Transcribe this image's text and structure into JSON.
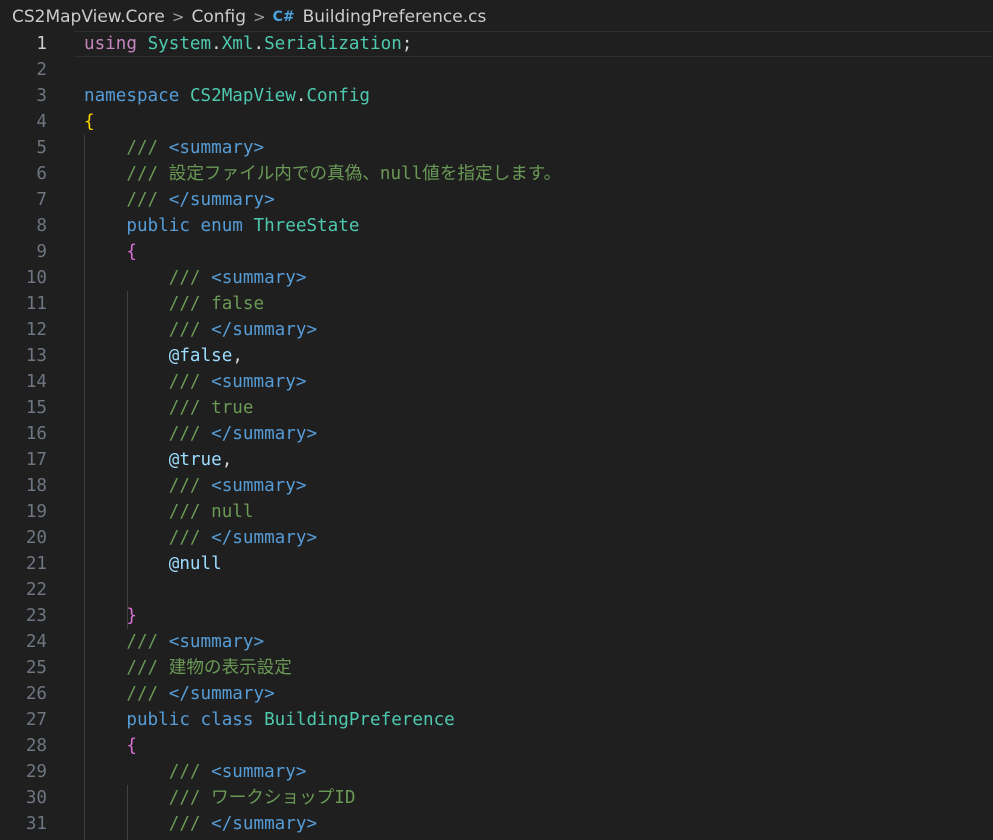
{
  "breadcrumb": {
    "items": [
      "CS2MapView.Core",
      "Config",
      "BuildingPreference.cs"
    ],
    "file_icon": "C#",
    "separator": ">"
  },
  "editor": {
    "active_line": 1,
    "lines": [
      {
        "n": 1,
        "tokens": [
          [
            "kw-pink",
            "using"
          ],
          [
            "plain",
            " "
          ],
          [
            "ns",
            "System"
          ],
          [
            "plain",
            "."
          ],
          [
            "ns",
            "Xml"
          ],
          [
            "plain",
            "."
          ],
          [
            "ns",
            "Serialization"
          ],
          [
            "plain",
            ";"
          ]
        ]
      },
      {
        "n": 2,
        "tokens": []
      },
      {
        "n": 3,
        "tokens": [
          [
            "kw",
            "namespace"
          ],
          [
            "plain",
            " "
          ],
          [
            "ns",
            "CS2MapView"
          ],
          [
            "plain",
            "."
          ],
          [
            "ns",
            "Config"
          ]
        ]
      },
      {
        "n": 4,
        "tokens": [
          [
            "br1",
            "{"
          ]
        ]
      },
      {
        "n": 5,
        "tokens": [
          [
            "plain",
            "    "
          ],
          [
            "cm",
            "/// "
          ],
          [
            "tag",
            "<summary>"
          ]
        ]
      },
      {
        "n": 6,
        "tokens": [
          [
            "plain",
            "    "
          ],
          [
            "cm",
            "/// 設定ファイル内での真偽、null値を指定します。"
          ]
        ]
      },
      {
        "n": 7,
        "tokens": [
          [
            "plain",
            "    "
          ],
          [
            "cm",
            "/// "
          ],
          [
            "tag",
            "</summary>"
          ]
        ]
      },
      {
        "n": 8,
        "tokens": [
          [
            "plain",
            "    "
          ],
          [
            "kw",
            "public"
          ],
          [
            "plain",
            " "
          ],
          [
            "kw",
            "enum"
          ],
          [
            "plain",
            " "
          ],
          [
            "ns",
            "ThreeState"
          ]
        ]
      },
      {
        "n": 9,
        "tokens": [
          [
            "plain",
            "    "
          ],
          [
            "br2",
            "{"
          ]
        ]
      },
      {
        "n": 10,
        "tokens": [
          [
            "plain",
            "        "
          ],
          [
            "cm",
            "/// "
          ],
          [
            "tag",
            "<summary>"
          ]
        ]
      },
      {
        "n": 11,
        "tokens": [
          [
            "plain",
            "        "
          ],
          [
            "cm",
            "/// false"
          ]
        ]
      },
      {
        "n": 12,
        "tokens": [
          [
            "plain",
            "        "
          ],
          [
            "cm",
            "/// "
          ],
          [
            "tag",
            "</summary>"
          ]
        ]
      },
      {
        "n": 13,
        "tokens": [
          [
            "plain",
            "        "
          ],
          [
            "ident",
            "@false"
          ],
          [
            "plain",
            ","
          ]
        ]
      },
      {
        "n": 14,
        "tokens": [
          [
            "plain",
            "        "
          ],
          [
            "cm",
            "/// "
          ],
          [
            "tag",
            "<summary>"
          ]
        ]
      },
      {
        "n": 15,
        "tokens": [
          [
            "plain",
            "        "
          ],
          [
            "cm",
            "/// true"
          ]
        ]
      },
      {
        "n": 16,
        "tokens": [
          [
            "plain",
            "        "
          ],
          [
            "cm",
            "/// "
          ],
          [
            "tag",
            "</summary>"
          ]
        ]
      },
      {
        "n": 17,
        "tokens": [
          [
            "plain",
            "        "
          ],
          [
            "ident",
            "@true"
          ],
          [
            "plain",
            ","
          ]
        ]
      },
      {
        "n": 18,
        "tokens": [
          [
            "plain",
            "        "
          ],
          [
            "cm",
            "/// "
          ],
          [
            "tag",
            "<summary>"
          ]
        ]
      },
      {
        "n": 19,
        "tokens": [
          [
            "plain",
            "        "
          ],
          [
            "cm",
            "/// null"
          ]
        ]
      },
      {
        "n": 20,
        "tokens": [
          [
            "plain",
            "        "
          ],
          [
            "cm",
            "/// "
          ],
          [
            "tag",
            "</summary>"
          ]
        ]
      },
      {
        "n": 21,
        "tokens": [
          [
            "plain",
            "        "
          ],
          [
            "ident",
            "@null"
          ]
        ]
      },
      {
        "n": 22,
        "tokens": []
      },
      {
        "n": 23,
        "tokens": [
          [
            "plain",
            "    "
          ],
          [
            "br2",
            "}"
          ]
        ]
      },
      {
        "n": 24,
        "tokens": [
          [
            "plain",
            "    "
          ],
          [
            "cm",
            "/// "
          ],
          [
            "tag",
            "<summary>"
          ]
        ]
      },
      {
        "n": 25,
        "tokens": [
          [
            "plain",
            "    "
          ],
          [
            "cm",
            "/// 建物の表示設定"
          ]
        ]
      },
      {
        "n": 26,
        "tokens": [
          [
            "plain",
            "    "
          ],
          [
            "cm",
            "/// "
          ],
          [
            "tag",
            "</summary>"
          ]
        ]
      },
      {
        "n": 27,
        "tokens": [
          [
            "plain",
            "    "
          ],
          [
            "kw",
            "public"
          ],
          [
            "plain",
            " "
          ],
          [
            "kw",
            "class"
          ],
          [
            "plain",
            " "
          ],
          [
            "ns",
            "BuildingPreference"
          ]
        ]
      },
      {
        "n": 28,
        "tokens": [
          [
            "plain",
            "    "
          ],
          [
            "br2",
            "{"
          ]
        ]
      },
      {
        "n": 29,
        "tokens": [
          [
            "plain",
            "        "
          ],
          [
            "cm",
            "/// "
          ],
          [
            "tag",
            "<summary>"
          ]
        ]
      },
      {
        "n": 30,
        "tokens": [
          [
            "plain",
            "        "
          ],
          [
            "cm",
            "/// ワークショップID"
          ]
        ]
      },
      {
        "n": 31,
        "tokens": [
          [
            "plain",
            "        "
          ],
          [
            "cm",
            "/// "
          ],
          [
            "tag",
            "</summary>"
          ]
        ]
      }
    ]
  }
}
